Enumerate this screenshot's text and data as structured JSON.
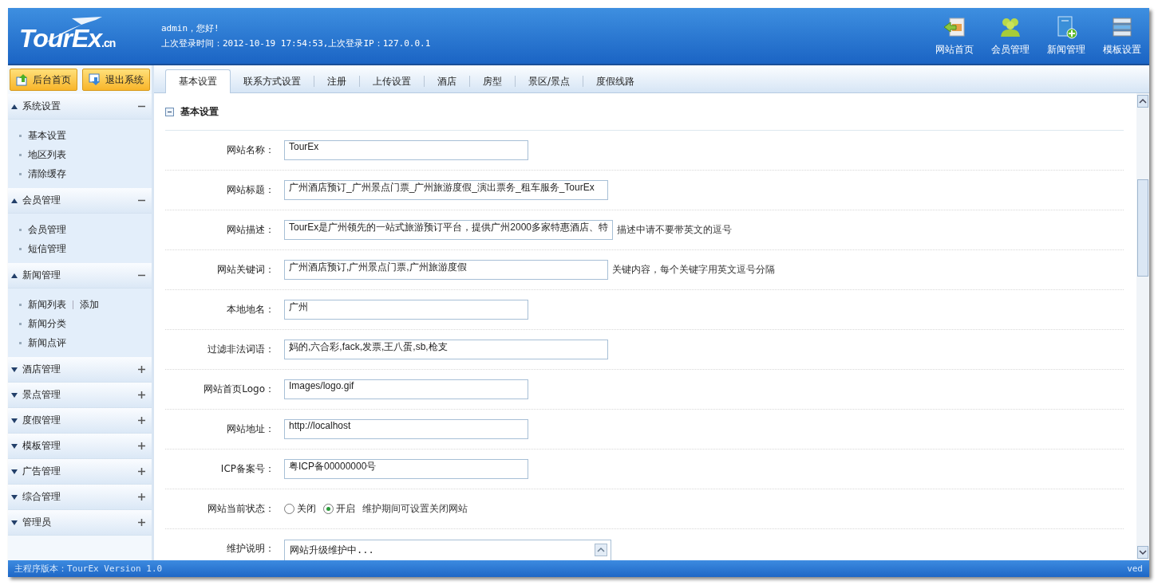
{
  "header": {
    "logo": "TourEx",
    "logo_suffix": ".cn",
    "greeting": "admin，您好!",
    "last_login": "上次登录时间：2012-10-19 17:54:53,上次登录IP：127.0.0.1",
    "shortcuts": [
      {
        "label": "网站首页",
        "kind": "home"
      },
      {
        "label": "会员管理",
        "kind": "users"
      },
      {
        "label": "新闻管理",
        "kind": "news"
      },
      {
        "label": "模板设置",
        "kind": "template"
      }
    ]
  },
  "sidebar": {
    "buttons": [
      {
        "label": "后台首页",
        "kind": "up"
      },
      {
        "label": "退出系统",
        "kind": "down"
      }
    ],
    "sections": [
      {
        "title": "系统设置",
        "expanded": true,
        "items": [
          {
            "label": "基本设置"
          },
          {
            "label": "地区列表"
          },
          {
            "label": "清除缓存"
          }
        ]
      },
      {
        "title": "会员管理",
        "expanded": true,
        "items": [
          {
            "label": "会员管理"
          },
          {
            "label": "短信管理"
          }
        ]
      },
      {
        "title": "新闻管理",
        "expanded": true,
        "items": [
          {
            "label": "新闻列表",
            "extra": "添加"
          },
          {
            "label": "新闻分类"
          },
          {
            "label": "新闻点评"
          }
        ]
      },
      {
        "title": "酒店管理",
        "expanded": false
      },
      {
        "title": "景点管理",
        "expanded": false
      },
      {
        "title": "度假管理",
        "expanded": false
      },
      {
        "title": "模板管理",
        "expanded": false
      },
      {
        "title": "广告管理",
        "expanded": false
      },
      {
        "title": "综合管理",
        "expanded": false
      },
      {
        "title": "管理员",
        "expanded": false
      }
    ]
  },
  "tabs": [
    {
      "label": "基本设置",
      "selected": true
    },
    {
      "label": "联系方式设置",
      "selected": false
    },
    {
      "label": "注册",
      "selected": false
    },
    {
      "label": "上传设置",
      "selected": false
    },
    {
      "label": "酒店",
      "selected": false
    },
    {
      "label": "房型",
      "selected": false
    },
    {
      "label": "景区/景点",
      "selected": false
    },
    {
      "label": "度假线路",
      "selected": false
    }
  ],
  "panel": {
    "title": "基本设置",
    "expanded": true,
    "rows": [
      {
        "label": "网站名称：",
        "kind": "text",
        "value": "TourEx"
      },
      {
        "label": "网站标题：",
        "kind": "wide-text",
        "value": "广州酒店预订_广州景点门票_广州旅游度假_演出票务_租车服务_TourEx"
      },
      {
        "label": "网站描述：",
        "kind": "wide-text",
        "value": "TourEx是广州领先的一站式旅游预订平台，提供广州2000多家特惠酒店、特",
        "hint": "描述中请不要带英文的逗号"
      },
      {
        "label": "网站关键词：",
        "kind": "wide-text",
        "value": "广州酒店预订,广州景点门票,广州旅游度假",
        "hint": "关键内容，每个关键字用英文逗号分隔"
      },
      {
        "label": "本地地名：",
        "kind": "text",
        "value": "广州"
      },
      {
        "label": "过滤非法词语：",
        "kind": "wide-text",
        "value": "妈的,六合彩,fack,发票,王八蛋,sb,枪支"
      },
      {
        "label": "网站首页Logo：",
        "kind": "text",
        "value": "Images/logo.gif"
      },
      {
        "label": "网站地址：",
        "kind": "text",
        "value": "http://localhost"
      },
      {
        "label": "ICP备案号：",
        "kind": "text",
        "value": "粤ICP备00000000号"
      },
      {
        "label": "网站当前状态：",
        "kind": "radio",
        "options": [
          {
            "label": "关闭",
            "selected": false
          },
          {
            "label": "开启",
            "selected": true
          }
        ],
        "hint": "维护期间可设置关闭网站"
      },
      {
        "label": "维护说明：",
        "kind": "textarea",
        "value": "网站升级维护中..."
      }
    ]
  },
  "status_bar": {
    "version": "主程序版本：TourEx Version 1.0",
    "right": "ved"
  }
}
